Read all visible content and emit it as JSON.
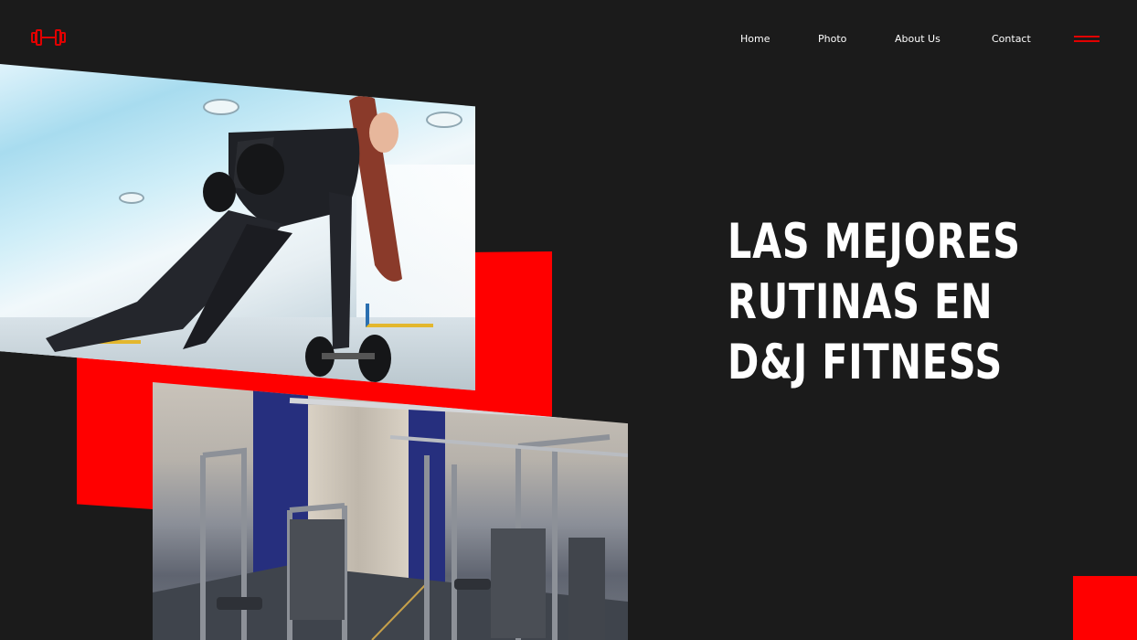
{
  "brand": {
    "logo_icon": "dumbbell-icon",
    "accent": "#ff0000"
  },
  "nav": {
    "items": [
      {
        "label": "Home"
      },
      {
        "label": "Photo"
      },
      {
        "label": "About Us"
      },
      {
        "label": "Contact"
      }
    ],
    "menu_icon": "hamburger-menu-icon"
  },
  "hero": {
    "title_lines": [
      "LAS MEJORES",
      "RUTINAS EN",
      "D&J FITNESS"
    ]
  },
  "colors": {
    "background": "#1b1b1b",
    "text": "#ffffff",
    "accent": "#ff0000"
  }
}
